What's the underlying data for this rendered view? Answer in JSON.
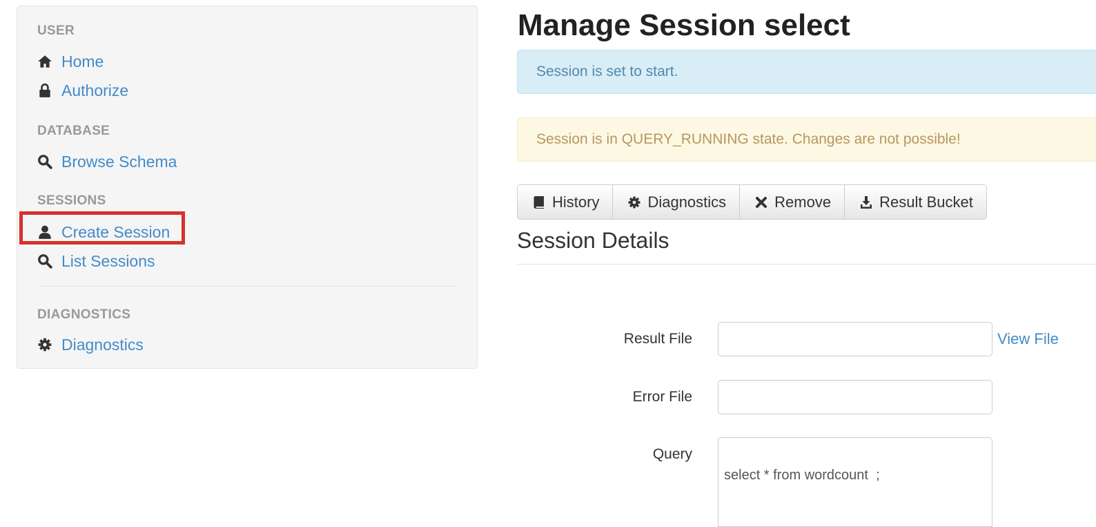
{
  "sidebar": {
    "sections": {
      "user": {
        "header": "USER",
        "items": [
          {
            "label": "Home",
            "icon": "home-icon"
          },
          {
            "label": "Authorize",
            "icon": "lock-icon"
          }
        ]
      },
      "database": {
        "header": "DATABASE",
        "items": [
          {
            "label": "Browse Schema",
            "icon": "search-icon"
          }
        ]
      },
      "sessions": {
        "header": "SESSIONS",
        "items": [
          {
            "label": "Create Session",
            "icon": "user-icon",
            "highlighted": true
          },
          {
            "label": "List Sessions",
            "icon": "search-icon"
          }
        ]
      },
      "diagnostics": {
        "header": "DIAGNOSTICS",
        "items": [
          {
            "label": "Diagnostics",
            "icon": "gear-icon"
          }
        ]
      }
    }
  },
  "main": {
    "title": "Manage Session select",
    "alerts": {
      "info": "Session is set to start.",
      "warning": "Session is in QUERY_RUNNING state. Changes are not possible!"
    },
    "toolbar": [
      {
        "label": "History",
        "icon": "book-icon"
      },
      {
        "label": "Diagnostics",
        "icon": "gear-icon"
      },
      {
        "label": "Remove",
        "icon": "close-icon"
      },
      {
        "label": "Result Bucket",
        "icon": "download-icon"
      }
    ],
    "details": {
      "title": "Session Details",
      "result_file": {
        "label": "Result File",
        "value": "",
        "link": "View File"
      },
      "error_file": {
        "label": "Error File",
        "value": ""
      },
      "query": {
        "label": "Query",
        "value": "select * from wordcount  ;"
      }
    }
  },
  "colors": {
    "link": "#428bca",
    "highlight": "#d7312c",
    "info_bg": "#d9edf7",
    "warning_bg": "#fcf8e3"
  }
}
